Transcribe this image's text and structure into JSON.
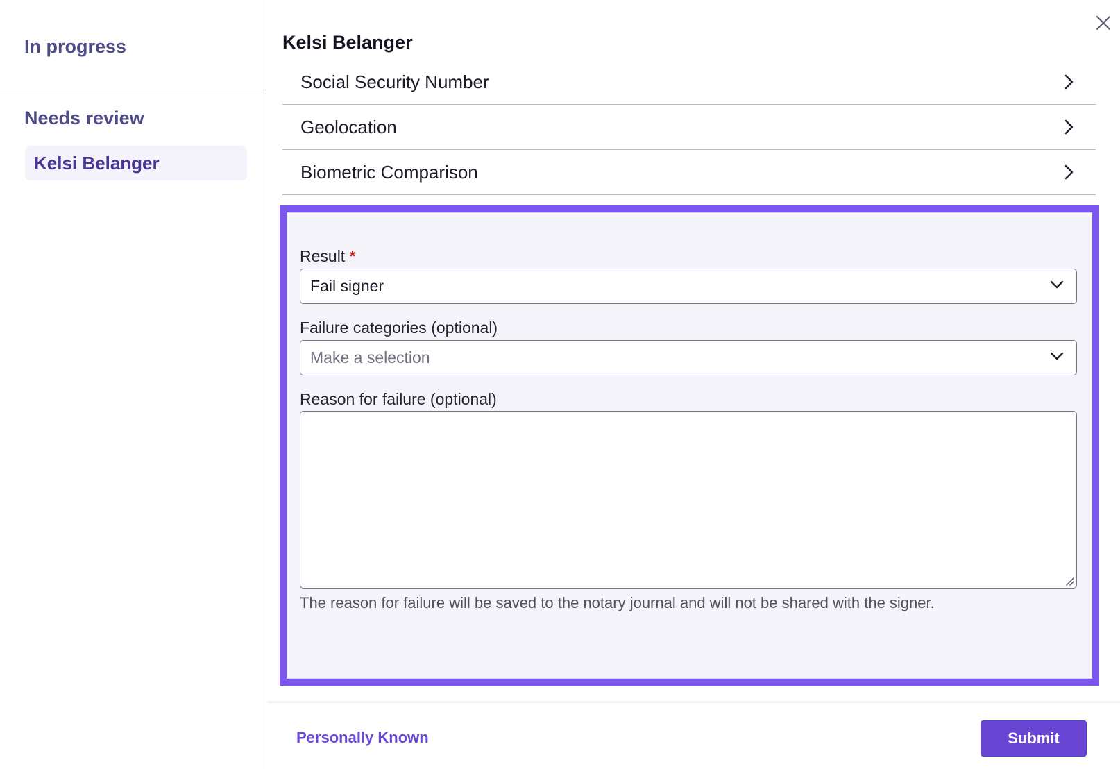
{
  "sidebar": {
    "in_progress_heading": "In progress",
    "needs_review_heading": "Needs review",
    "items": [
      {
        "label": "Kelsi Belanger",
        "selected": true
      }
    ]
  },
  "panel": {
    "title": "Kelsi Belanger",
    "close_icon": "close-icon",
    "sections": [
      {
        "label": "Social Security Number"
      },
      {
        "label": "Geolocation"
      },
      {
        "label": "Biometric Comparison"
      }
    ],
    "form": {
      "result_label": "Result",
      "required_marker": "*",
      "result_value": "Fail signer",
      "failure_categories_label": "Failure categories (optional)",
      "failure_categories_placeholder": "Make a selection",
      "reason_label": "Reason for failure (optional)",
      "reason_value": "",
      "help_text": "The reason for failure will be saved to the notary journal and will not be shared with the signer."
    },
    "footer": {
      "personally_known_label": "Personally Known",
      "submit_label": "Submit"
    }
  },
  "colors": {
    "accent": "#7c54ee",
    "primary_button": "#6a46d4",
    "link": "#6a4ad6",
    "sidebar_heading": "#4f4a88",
    "required": "#b3261e"
  }
}
